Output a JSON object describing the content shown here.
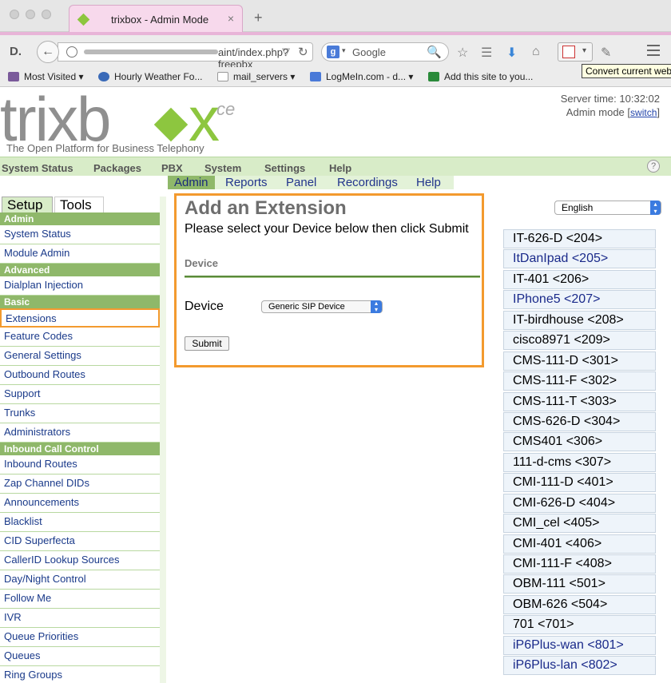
{
  "browser": {
    "tab_title": "trixbox - Admin Mode",
    "tab_close": "×",
    "new_tab": "+",
    "logo_letter": "D.",
    "back": "←",
    "url_text": "aint/index.php?freepbx",
    "url_star": "▽",
    "reload": "↻",
    "search_engine_letter": "g",
    "search_caret": "▾",
    "search_placeholder": "Google",
    "search_icon": "🔍",
    "star_icon": "☆",
    "reader_icon": "☰",
    "download_icon": "⬇",
    "home_icon": "⌂",
    "ext_caret": "▾",
    "tools_icon": "✎",
    "bookmarks": [
      {
        "label": "Most Visited",
        "caret": "▾",
        "color": "#7a5a9a"
      },
      {
        "label": "Hourly Weather Fo...",
        "caret": "",
        "color": "#3a6ab8"
      },
      {
        "label": "mail_servers",
        "caret": "▾",
        "color": "#999999"
      },
      {
        "label": "LogMeIn.com - d...",
        "caret": "▾",
        "color": "#4a7ad8"
      },
      {
        "label": "Add this site to you...",
        "caret": "",
        "color": "#2a8a3a"
      }
    ],
    "tooltip": "Convert current web"
  },
  "header": {
    "logo_trix": "trixb",
    "logo_x": "x",
    "logo_ce": "ce",
    "tagline": "The Open Platform for Business Telephony",
    "server_time": "Server time: 10:32:02",
    "admin_mode": "Admin mode",
    "switch_link": "switch",
    "bracket_open": "[",
    "bracket_close": "]"
  },
  "main_nav": [
    "System Status",
    "Packages",
    "PBX",
    "System",
    "Settings",
    "Help"
  ],
  "help_icon": "?",
  "sub_nav": [
    {
      "label": "Admin",
      "active": true
    },
    {
      "label": "Reports",
      "active": false
    },
    {
      "label": "Panel",
      "active": false
    },
    {
      "label": "Recordings",
      "active": false
    },
    {
      "label": "Help",
      "active": false
    }
  ],
  "sidebar": {
    "tabs": [
      "Setup",
      "Tools"
    ],
    "sections": [
      {
        "heading": "Admin",
        "items": [
          "System Status",
          "Module Admin"
        ]
      },
      {
        "heading": "Advanced",
        "items": [
          "Dialplan Injection"
        ]
      },
      {
        "heading": "Basic",
        "items": [
          "Extensions",
          "Feature Codes",
          "General Settings",
          "Outbound Routes",
          "Support",
          "Trunks",
          "Administrators"
        ]
      },
      {
        "heading": "Inbound Call Control",
        "items": [
          "Inbound Routes",
          "Zap Channel DIDs",
          "Announcements",
          "Blacklist",
          "CID Superfecta",
          "CallerID Lookup Sources",
          "Day/Night Control",
          "Follow Me",
          "IVR",
          "Queue Priorities",
          "Queues",
          "Ring Groups"
        ]
      }
    ],
    "selected": "Extensions"
  },
  "form": {
    "title": "Add an Extension",
    "instructions": "Please select your Device below then click Submit",
    "section": "Device",
    "device_label": "Device",
    "device_value": "Generic SIP Device",
    "submit": "Submit"
  },
  "language": {
    "value": "English",
    "arrows": "▴▾"
  },
  "extensions": [
    {
      "label": "IT-626-D <204>",
      "blue": false
    },
    {
      "label": "ItDanIpad <205>",
      "blue": true
    },
    {
      "label": "IT-401 <206>",
      "blue": false
    },
    {
      "label": "IPhone5 <207>",
      "blue": true
    },
    {
      "label": "IT-birdhouse <208>",
      "blue": false
    },
    {
      "label": "cisco8971 <209>",
      "blue": false
    },
    {
      "label": "CMS-111-D <301>",
      "blue": false
    },
    {
      "label": "CMS-111-F <302>",
      "blue": false
    },
    {
      "label": "CMS-111-T <303>",
      "blue": false
    },
    {
      "label": "CMS-626-D <304>",
      "blue": false
    },
    {
      "label": "CMS401 <306>",
      "blue": false
    },
    {
      "label": "111-d-cms <307>",
      "blue": false
    },
    {
      "label": "CMI-111-D <401>",
      "blue": false
    },
    {
      "label": "CMI-626-D <404>",
      "blue": false
    },
    {
      "label": "CMI_cel <405>",
      "blue": false
    },
    {
      "label": "CMI-401 <406>",
      "blue": false
    },
    {
      "label": "CMI-111-F <408>",
      "blue": false
    },
    {
      "label": "OBM-111 <501>",
      "blue": false
    },
    {
      "label": "OBM-626 <504>",
      "blue": false
    },
    {
      "label": "701 <701>",
      "blue": false
    },
    {
      "label": "iP6Plus-wan <801>",
      "blue": true
    },
    {
      "label": "iP6Plus-lan <802>",
      "blue": true
    }
  ],
  "colors": {
    "accent_orange": "#f39a2e",
    "trixbox_green": "#8dc63f",
    "nav_green": "#8fb86a"
  }
}
